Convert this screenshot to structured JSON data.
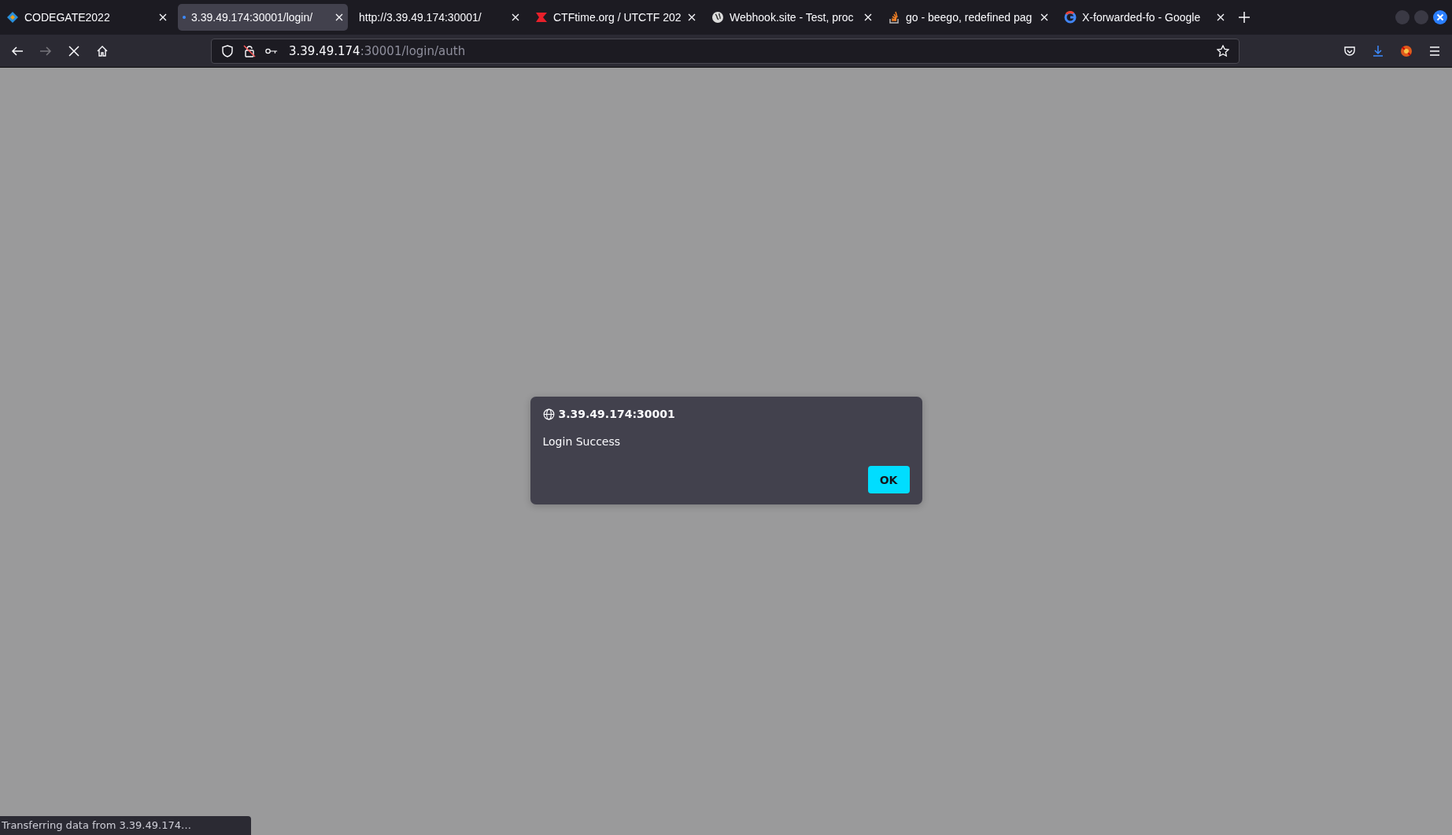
{
  "tabs": [
    {
      "title": "CODEGATE2022",
      "loading": false,
      "selected": false
    },
    {
      "title": "3.39.49.174:30001/login/",
      "loading": true,
      "selected": true
    },
    {
      "title": "http://3.39.49.174:30001/",
      "loading": false,
      "selected": false
    },
    {
      "title": "CTFtime.org / UTCTF 202",
      "loading": false,
      "selected": false
    },
    {
      "title": "Webhook.site - Test, proc",
      "loading": false,
      "selected": false
    },
    {
      "title": "go - beego, redefined pag",
      "loading": false,
      "selected": false
    },
    {
      "title": "X-forwarded-fo - Google",
      "loading": false,
      "selected": false
    }
  ],
  "address": {
    "host": "3.39.49.174",
    "path": ":30001/login/auth"
  },
  "dialog": {
    "origin": "3.39.49.174:30001",
    "message": "Login Success",
    "button": "OK"
  },
  "status_bar": "Transferring data from 3.39.49.174…"
}
